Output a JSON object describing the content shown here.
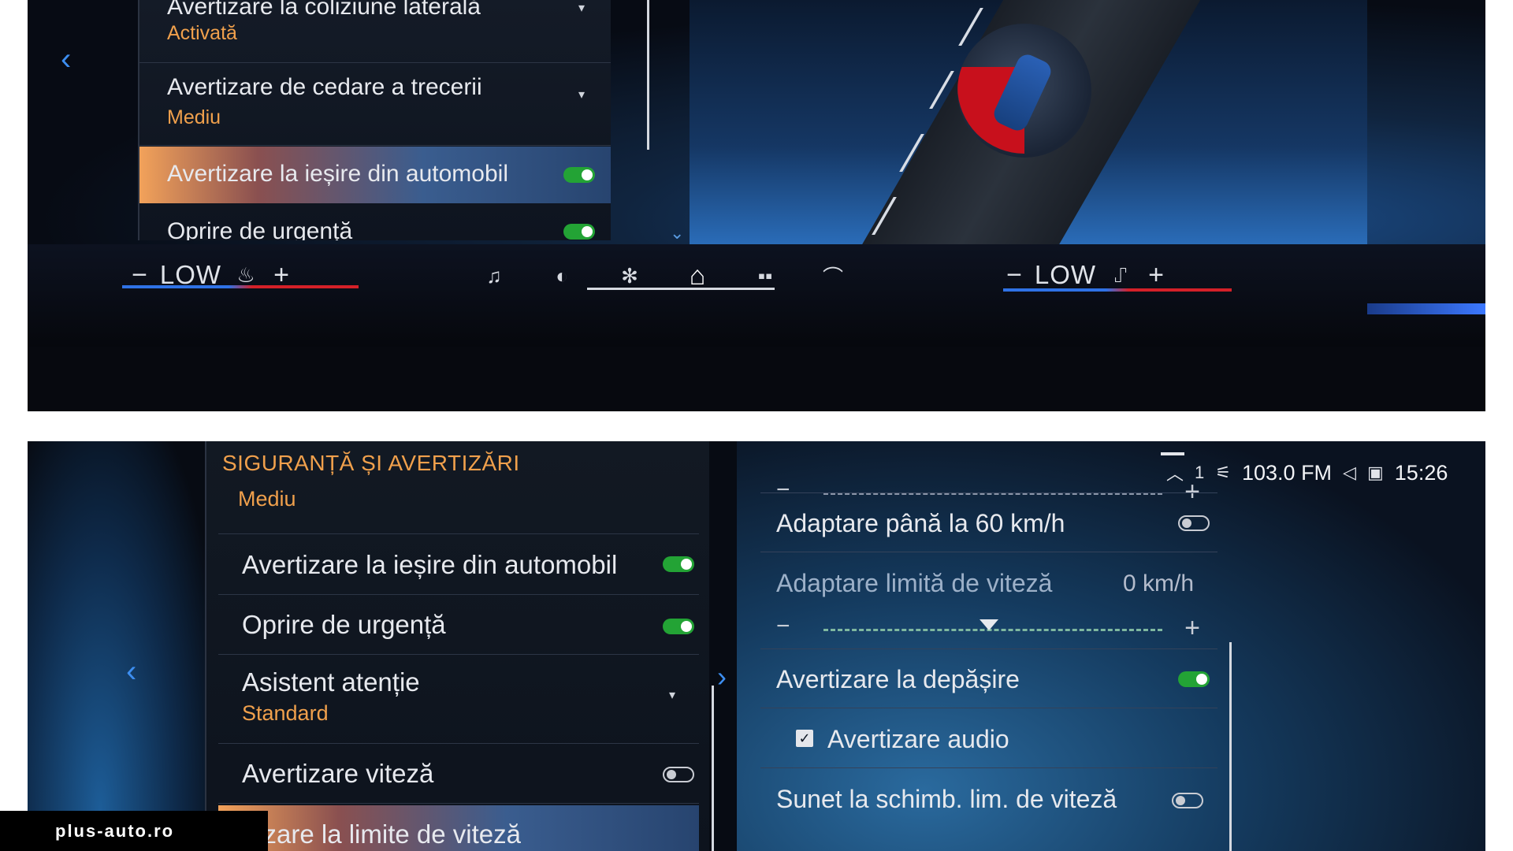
{
  "top_screen": {
    "menu_items": [
      {
        "label": "Avertizare la coliziune laterală",
        "value": "Activată",
        "control": "dropdown"
      },
      {
        "label": "Avertizare de cedare a trecerii",
        "value": "Mediu",
        "control": "dropdown"
      },
      {
        "label": "Avertizare la ieșire din automobil",
        "control": "toggle",
        "state": "on",
        "selected": true
      },
      {
        "label": "Oprire de urgență",
        "control": "toggle",
        "state": "on"
      }
    ],
    "climate_left": {
      "minus": "−",
      "level": "LOW",
      "seat_icon": "seat-heat-icon",
      "plus": "+"
    },
    "climate_right": {
      "minus": "−",
      "level": "LOW",
      "seat_icon": "seat-vent-icon",
      "plus": "+"
    },
    "nav_icons": [
      "music-icon",
      "navigation-icon",
      "fan-icon",
      "home-icon",
      "apps-icon",
      "phone-icon"
    ],
    "active_nav": "home-icon"
  },
  "bottom_screen": {
    "section_title": "SIGURANȚĂ ȘI AVERTIZĂRI",
    "section_value": "Mediu",
    "menu_items": [
      {
        "label": "Avertizare la ieșire din automobil",
        "control": "toggle",
        "state": "on"
      },
      {
        "label": "Oprire de urgență",
        "control": "toggle",
        "state": "on"
      },
      {
        "label": "Asistent atenție",
        "value": "Standard",
        "control": "dropdown"
      },
      {
        "label": "Avertizare viteză",
        "control": "toggle",
        "state": "off"
      },
      {
        "label": "...zare la limite de viteză",
        "selected": true
      }
    ],
    "status": {
      "radio": "103.0 FM",
      "time": "15:26",
      "profile": "1"
    },
    "right_list": {
      "adapt_60": {
        "label": "Adaptare până la 60 km/h",
        "state": "off"
      },
      "speed_adapt": {
        "label": "Adaptare limită de viteză",
        "value": "0 km/h"
      },
      "overtake": {
        "label": "Avertizare la depășire",
        "state": "on"
      },
      "audio": {
        "label": "Avertizare audio",
        "checked": true
      },
      "sound": {
        "label": "Sunet la schimb. lim. de viteză",
        "state": "off"
      }
    }
  },
  "watermark": "plus-auto.ro",
  "colors": {
    "accent_orange": "#f0a04c",
    "toggle_green": "#23a335",
    "arrow_blue": "#3d8ef0"
  }
}
